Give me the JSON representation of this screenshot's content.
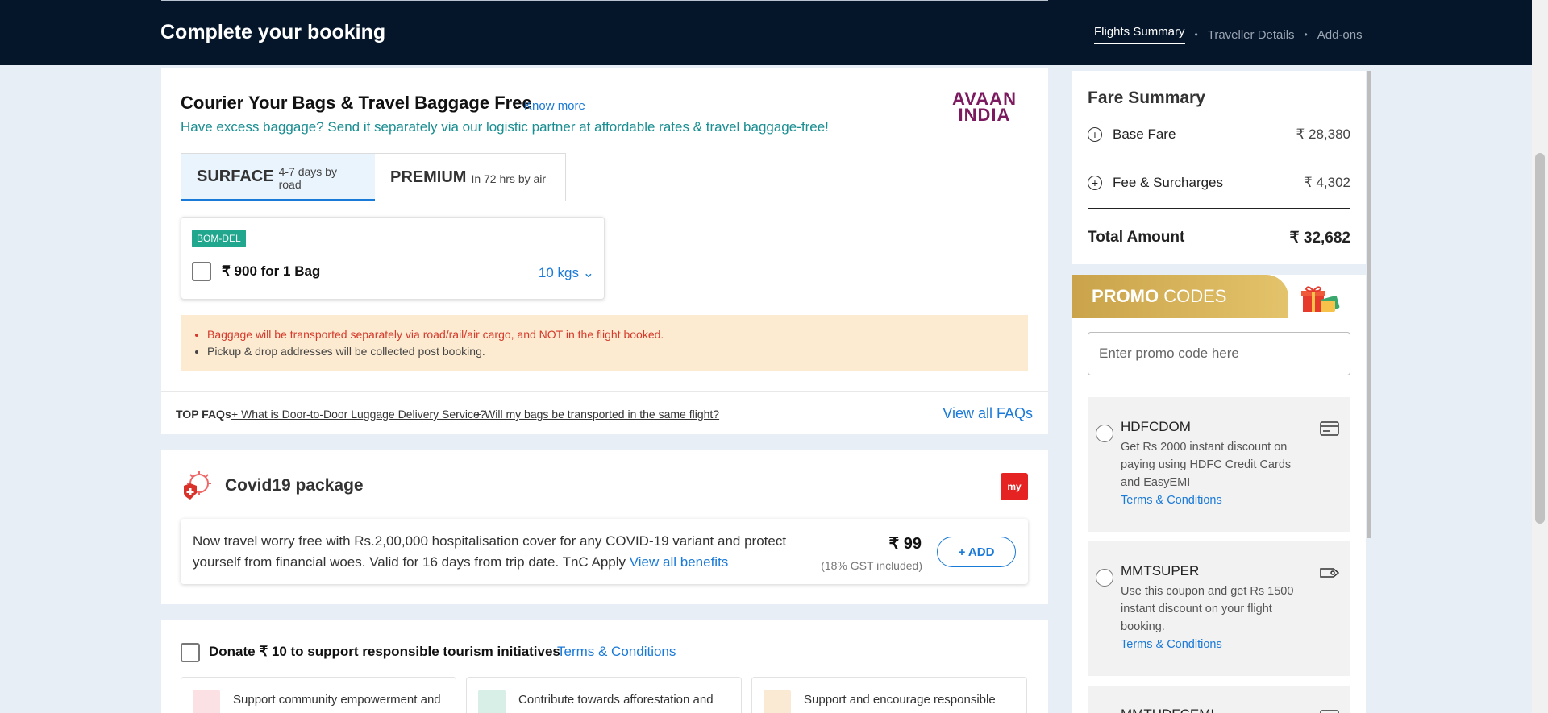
{
  "header": {
    "title": "Complete your booking",
    "steps": [
      "Flights Summary",
      "Traveller Details",
      "Add-ons"
    ]
  },
  "baggage": {
    "title": "Courier Your Bags & Travel Baggage Free",
    "know_more": "Know more",
    "subtitle": "Have excess baggage? Send it separately via our logistic partner at affordable rates & travel baggage-free!",
    "logo_line1": "AVAAN",
    "logo_line2": "INDIA",
    "tabs": [
      {
        "title": "SURFACE",
        "desc": "4-7 days by road"
      },
      {
        "title": "PREMIUM",
        "desc": "In 72 hrs by air"
      }
    ],
    "route": "BOM-DEL",
    "price": "₹ 900 for 1 Bag",
    "kgs": "10 kgs",
    "notices": [
      "Baggage will be transported separately via road/rail/air cargo, and NOT in the flight booked.",
      "Pickup & drop addresses will be collected post booking."
    ],
    "faq_label": "TOP FAQs",
    "faqs": [
      "+ What is Door-to-Door Luggage Delivery Service?",
      "+ Will my bags be transported in the same flight?"
    ],
    "view_all": "View all FAQs"
  },
  "covid": {
    "title": "Covid19 package",
    "logo": "my",
    "desc": "Now travel worry free with Rs.2,00,000 hospitalisation cover for any COVID-19 variant and protect yourself from financial woes. Valid for 16 days from trip date. TnC Apply",
    "link": "View all benefits",
    "price": "₹ 99",
    "gst": "(18% GST included)",
    "add": "+ ADD"
  },
  "donate": {
    "text": "Donate ₹ 10 to support responsible tourism initiatives",
    "tnc": "Terms & Conditions",
    "tiles": [
      "Support community empowerment and",
      "Contribute towards afforestation and",
      "Support and encourage responsible"
    ]
  },
  "fare": {
    "title": "Fare Summary",
    "rows": [
      {
        "label": "Base Fare",
        "value": "₹ 28,380"
      },
      {
        "label": "Fee & Surcharges",
        "value": "₹ 4,302"
      }
    ],
    "total_label": "Total Amount",
    "total_value": "₹ 32,682"
  },
  "promo": {
    "head_bold": "PROMO",
    "head_rest": " CODES",
    "placeholder": "Enter promo code here",
    "coupons": [
      {
        "code": "HDFCDOM",
        "desc": "Get Rs 2000 instant discount on paying using HDFC Credit Cards and EasyEMI",
        "tnc": "Terms & Conditions",
        "icon": "credit-card-icon"
      },
      {
        "code": "MMTSUPER",
        "desc": "Use this coupon and get Rs 1500 instant discount on your flight booking.",
        "tnc": "Terms & Conditions",
        "icon": "tag-icon"
      },
      {
        "code": "MMTHDFCEMI",
        "desc": "",
        "tnc": "",
        "icon": "credit-card-icon"
      }
    ]
  },
  "colors": {
    "header_bg": "#05162a",
    "accent": "#1a7ad8",
    "teal": "#1a8e91",
    "promo_gold": "#caa34a"
  }
}
